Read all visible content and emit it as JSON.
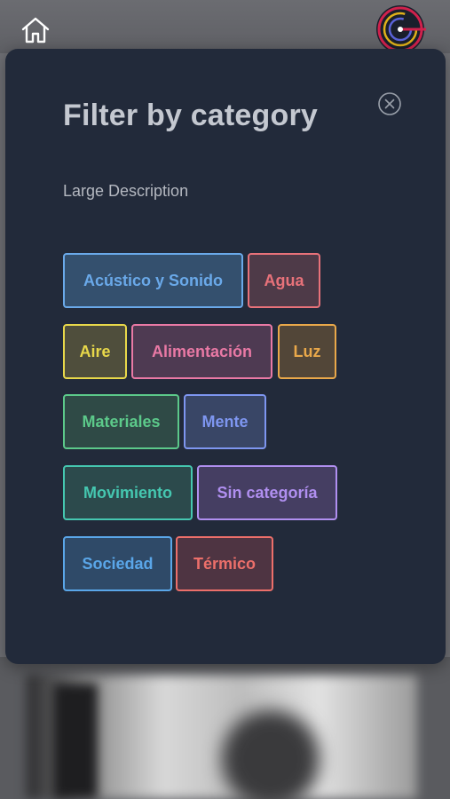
{
  "header": {
    "home_icon": "home-icon",
    "logo_icon": "app-logo"
  },
  "modal": {
    "title": "Filter by category",
    "subtitle": "Large Description",
    "close_icon": "close-icon"
  },
  "categories": [
    {
      "label": "Acústico y Sonido",
      "color": "#6aa9e9",
      "bg": "#34506e"
    },
    {
      "label": "Agua",
      "color": "#e8727a",
      "bg": "#4e3a48"
    },
    {
      "label": "Aire",
      "color": "#e8d84a",
      "bg": "#4f4e3c"
    },
    {
      "label": "Alimentación",
      "color": "#e979a5",
      "bg": "#4e3a52"
    },
    {
      "label": "Luz",
      "color": "#e9a84a",
      "bg": "#524638"
    },
    {
      "label": "Materiales",
      "color": "#5cc98a",
      "bg": "#2f4a46"
    },
    {
      "label": "Mente",
      "color": "#7e96f0",
      "bg": "#394666"
    },
    {
      "label": "Movimiento",
      "color": "#45c7b0",
      "bg": "#2c4a4c"
    },
    {
      "label": "Sin categoría",
      "color": "#b08ff0",
      "bg": "#453e62"
    },
    {
      "label": "Sociedad",
      "color": "#5aa6e8",
      "bg": "#2f4a68"
    },
    {
      "label": "Térmico",
      "color": "#ec6f6a",
      "bg": "#4e3442"
    }
  ]
}
